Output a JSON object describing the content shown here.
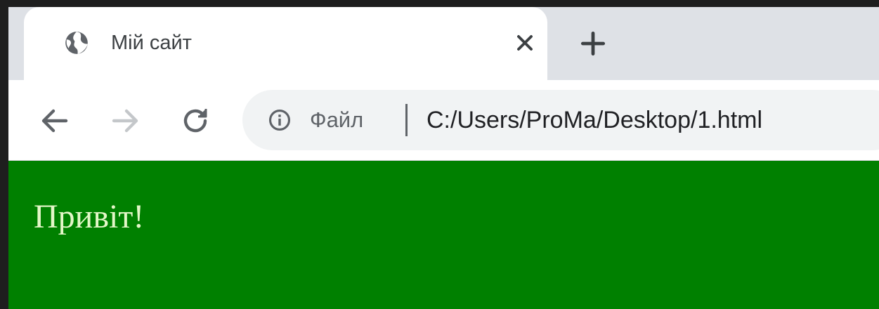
{
  "browser": {
    "tab": {
      "title": "Мій сайт",
      "favicon": "globe-icon",
      "close_icon": "close-icon"
    },
    "new_tab_icon": "plus-icon",
    "nav": {
      "back_icon": "arrow-left-icon",
      "forward_icon": "arrow-right-icon",
      "reload_icon": "reload-icon"
    },
    "omnibox": {
      "info_icon": "info-icon",
      "scheme_label": "Файл",
      "url": "C:/Users/ProMa/Desktop/1.html"
    }
  },
  "page": {
    "background_color": "#008000",
    "heading": "Привіт!"
  }
}
